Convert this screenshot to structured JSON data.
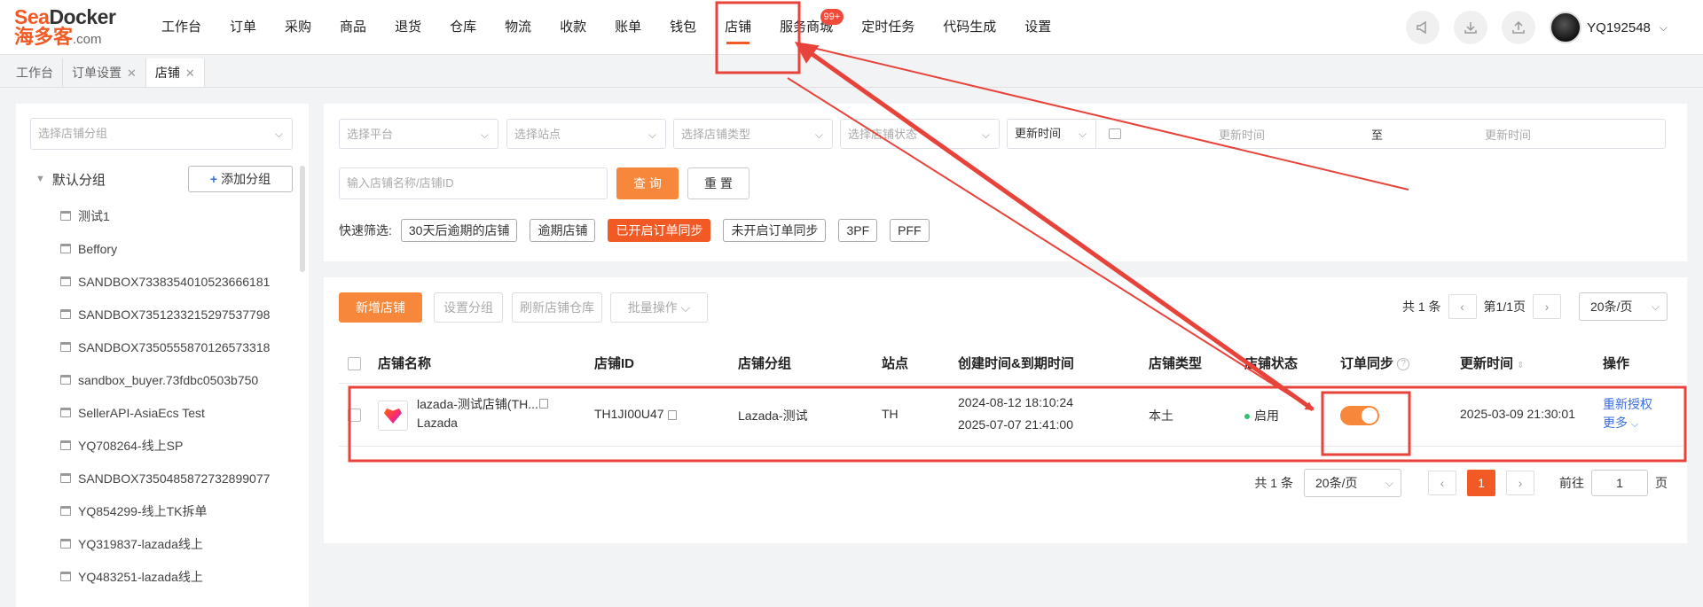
{
  "logo": {
    "line1_a": "Sea",
    "line1_b": "Docker",
    "line2": "海多客",
    "line2_suffix": ".com"
  },
  "nav": {
    "items": [
      "工作台",
      "订单",
      "采购",
      "商品",
      "退货",
      "仓库",
      "物流",
      "收款",
      "账单",
      "钱包",
      "店铺",
      "服务商城",
      "定时任务",
      "代码生成",
      "设置"
    ],
    "active_index": 10,
    "badge_value": "99+",
    "badge_index": 11
  },
  "user": {
    "name": "YQ192548"
  },
  "page_tabs": [
    "工作台",
    "订单设置",
    "店铺"
  ],
  "sidebar": {
    "group_select_placeholder": "选择店铺分组",
    "group_name": "默认分组",
    "add_group_label": "添加分组",
    "stores": [
      "测试1",
      "Beffory",
      "SANDBOX7338354010523666181",
      "SANDBOX7351233215297537798",
      "SANDBOX7350555870126573318",
      "sandbox_buyer.73fdbc0503b750",
      "SellerAPI-AsiaEcs Test",
      "YQ708264-线上SP",
      "SANDBOX7350485872732899077",
      "YQ854299-线上TK拆单",
      "YQ319837-lazada线上",
      "YQ483251-lazada线上"
    ]
  },
  "filters": {
    "platform_placeholder": "选择平台",
    "site_placeholder": "选择站点",
    "store_type_placeholder": "选择店铺类型",
    "store_status_placeholder": "选择店铺状态",
    "date_type": "更新时间",
    "date_start_placeholder": "更新时间",
    "date_separator": "至",
    "date_end_placeholder": "更新时间",
    "search_placeholder": "输入店铺名称/店铺ID",
    "query_label": "查 询",
    "reset_label": "重 置",
    "quick_label": "快速筛选:",
    "quick_tags": [
      "30天后逾期的店铺",
      "逾期店铺",
      "已开启订单同步",
      "未开启订单同步",
      "3PF",
      "PFF"
    ],
    "quick_active_index": 2
  },
  "toolbar": {
    "add_store": "新增店铺",
    "set_group": "设置分组",
    "refresh_warehouse": "刷新店铺仓库",
    "batch_ops": "批量操作"
  },
  "pager_top": {
    "total": "共 1 条",
    "page_info": "第1/1页",
    "page_size": "20条/页"
  },
  "table": {
    "headers": {
      "name": "店铺名称",
      "id": "店铺ID",
      "group": "店铺分组",
      "site": "站点",
      "time": "创建时间&到期时间",
      "type": "店铺类型",
      "status": "店铺状态",
      "sync": "订单同步",
      "updated": "更新时间",
      "actions": "操作"
    },
    "rows": [
      {
        "name": "lazada-测试店铺(TH...",
        "platform": "Lazada",
        "id": "TH1JI00U47",
        "group": "Lazada-测试",
        "site": "TH",
        "created": "2024-08-12 18:10:24",
        "expires": "2025-07-07 21:41:00",
        "type": "本土",
        "status": "启用",
        "updated": "2025-03-09 21:30:01",
        "action_reauth": "重新授权",
        "action_more": "更多"
      }
    ]
  },
  "pager_bottom": {
    "total": "共 1 条",
    "page_size": "20条/页",
    "current": "1",
    "goto_label": "前往",
    "goto_value": "1",
    "page_suffix": "页"
  },
  "colors": {
    "accent": "#f15a24",
    "button": "#f7873a",
    "annotation": "#e8433a",
    "link": "#3b6fe0"
  }
}
